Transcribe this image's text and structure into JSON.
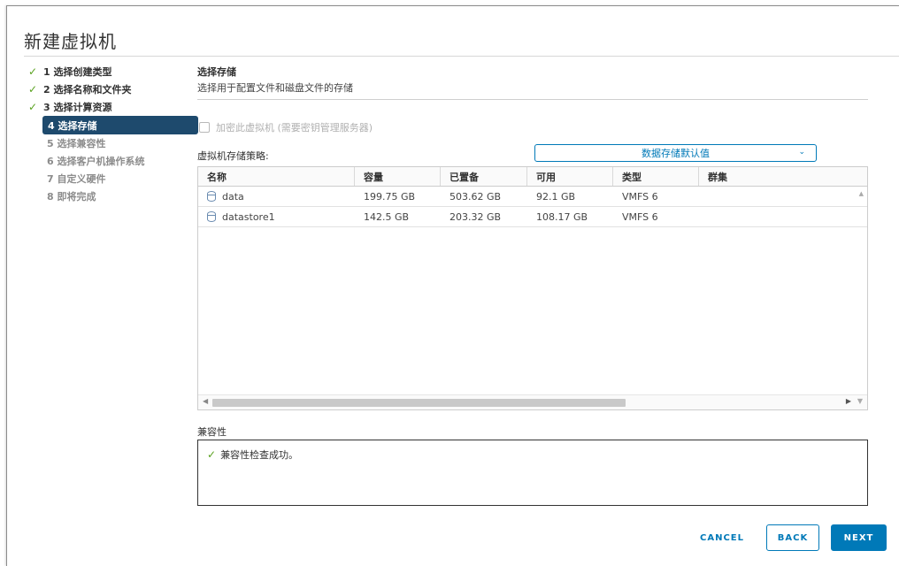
{
  "wizard": {
    "title": "新建虚拟机"
  },
  "steps": [
    {
      "label": "1 选择创建类型",
      "state": "done"
    },
    {
      "label": "2 选择名称和文件夹",
      "state": "done"
    },
    {
      "label": "3 选择计算资源",
      "state": "done"
    },
    {
      "label": "4 选择存储",
      "state": "active"
    },
    {
      "label": "5 选择兼容性",
      "state": "future"
    },
    {
      "label": "6 选择客户机操作系统",
      "state": "future"
    },
    {
      "label": "7 自定义硬件",
      "state": "future"
    },
    {
      "label": "8 即将完成",
      "state": "future"
    }
  ],
  "section": {
    "title": "选择存储",
    "description": "选择用于配置文件和磁盘文件的存储"
  },
  "encrypt": {
    "label": "加密此虚拟机 (需要密钥管理服务器)"
  },
  "policy": {
    "label": "虚拟机存储策略:",
    "value": "数据存储默认值"
  },
  "table": {
    "columns": [
      "名称",
      "容量",
      "已置备",
      "可用",
      "类型",
      "群集"
    ],
    "rows": [
      {
        "name": "data",
        "capacity": "199.75 GB",
        "provisioned": "503.62 GB",
        "free": "92.1 GB",
        "type": "VMFS 6",
        "cluster": ""
      },
      {
        "name": "datastore1",
        "capacity": "142.5 GB",
        "provisioned": "203.32 GB",
        "free": "108.17 GB",
        "type": "VMFS 6",
        "cluster": ""
      }
    ]
  },
  "compatibility": {
    "label": "兼容性",
    "message": "兼容性检查成功。"
  },
  "buttons": {
    "cancel": "CANCEL",
    "back": "BACK",
    "next": "NEXT"
  },
  "icons": {
    "check": "check-icon",
    "datastore": "database-icon",
    "chevron": "chevron-down-icon"
  },
  "colors": {
    "accent": "#0079b8",
    "active_step": "#1e4a6d",
    "success": "#5aa220"
  }
}
